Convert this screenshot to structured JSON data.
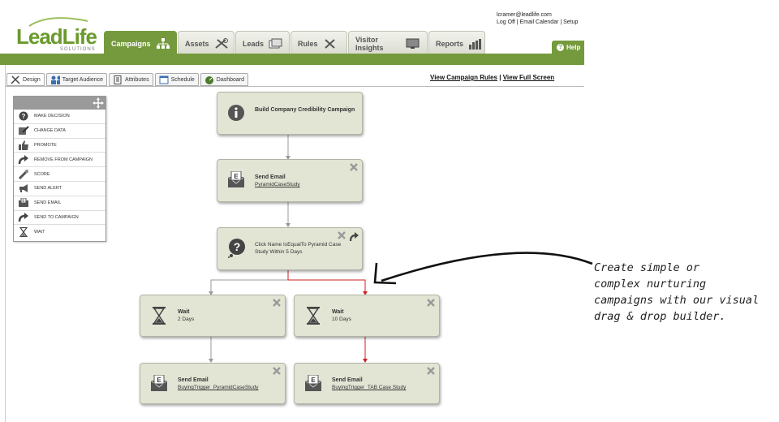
{
  "logo": {
    "text": "LeadLife",
    "sub": "SOLUTIONS"
  },
  "user": {
    "email": "lcramer@leadlife.com",
    "log_off": "Log Off",
    "email_calendar": "Email Calendar",
    "setup": "Setup"
  },
  "nav": {
    "tabs": [
      {
        "label": "Campaigns",
        "icon": "hierarchy-icon"
      },
      {
        "label": "Assets",
        "icon": "tools-icon"
      },
      {
        "label": "Leads",
        "icon": "cards-icon"
      },
      {
        "label": "Rules",
        "icon": "wrench-icon"
      },
      {
        "label": "Visitor Insights",
        "icon": "monitor-icon"
      },
      {
        "label": "Reports",
        "icon": "bar-chart-icon"
      }
    ],
    "help": "Help"
  },
  "subtabs": [
    "Design",
    "Target Audience",
    "Attributes",
    "Schedule",
    "Dashboard"
  ],
  "links": {
    "rules": "View Campaign Rules",
    "separator": "|",
    "fullscreen": "View Full Screen"
  },
  "palette": [
    {
      "label": "MAKE DECISION",
      "icon": "question-icon"
    },
    {
      "label": "CHANGE DATA",
      "icon": "edit-data-icon"
    },
    {
      "label": "PROMOTE",
      "icon": "thumbs-up-icon"
    },
    {
      "label": "REMOVE FROM CAMPAIGN",
      "icon": "redirect-arrow-icon"
    },
    {
      "label": "SCORE",
      "icon": "score-icon"
    },
    {
      "label": "SEND ALERT",
      "icon": "megaphone-icon"
    },
    {
      "label": "SEND EMAIL",
      "icon": "email-icon"
    },
    {
      "label": "SEND TO CAMPAIGN",
      "icon": "forward-arrow-icon"
    },
    {
      "label": "WAIT",
      "icon": "hourglass-icon"
    }
  ],
  "nodes": {
    "start": {
      "title": "Build Company Credibility Campaign"
    },
    "email1": {
      "title": "Send Email",
      "sub": "PyramidCaseStudy"
    },
    "decision": {
      "line1": "Click Name IsEqualTo Pyramid Case",
      "line2": "Study Within 5 Days"
    },
    "wait_left": {
      "title": "Wait",
      "sub": "2 Days"
    },
    "wait_right": {
      "title": "Wait",
      "sub": "10 Days"
    },
    "email_left": {
      "title": "Send Email",
      "sub": "BuyingTrigger_PyramidCaseStudy"
    },
    "email_right": {
      "title": "Send Email",
      "sub": "BuyingTrigger_TAB Case Study"
    }
  },
  "annotation": [
    "Create simple or",
    "complex nurturing",
    "campaigns with our visual",
    "drag & drop builder."
  ],
  "colors": {
    "brand_green": "#759a3d",
    "node_bg": "#e2e5d4",
    "connector_red": "#cc2222",
    "connector_gray": "#999999"
  }
}
